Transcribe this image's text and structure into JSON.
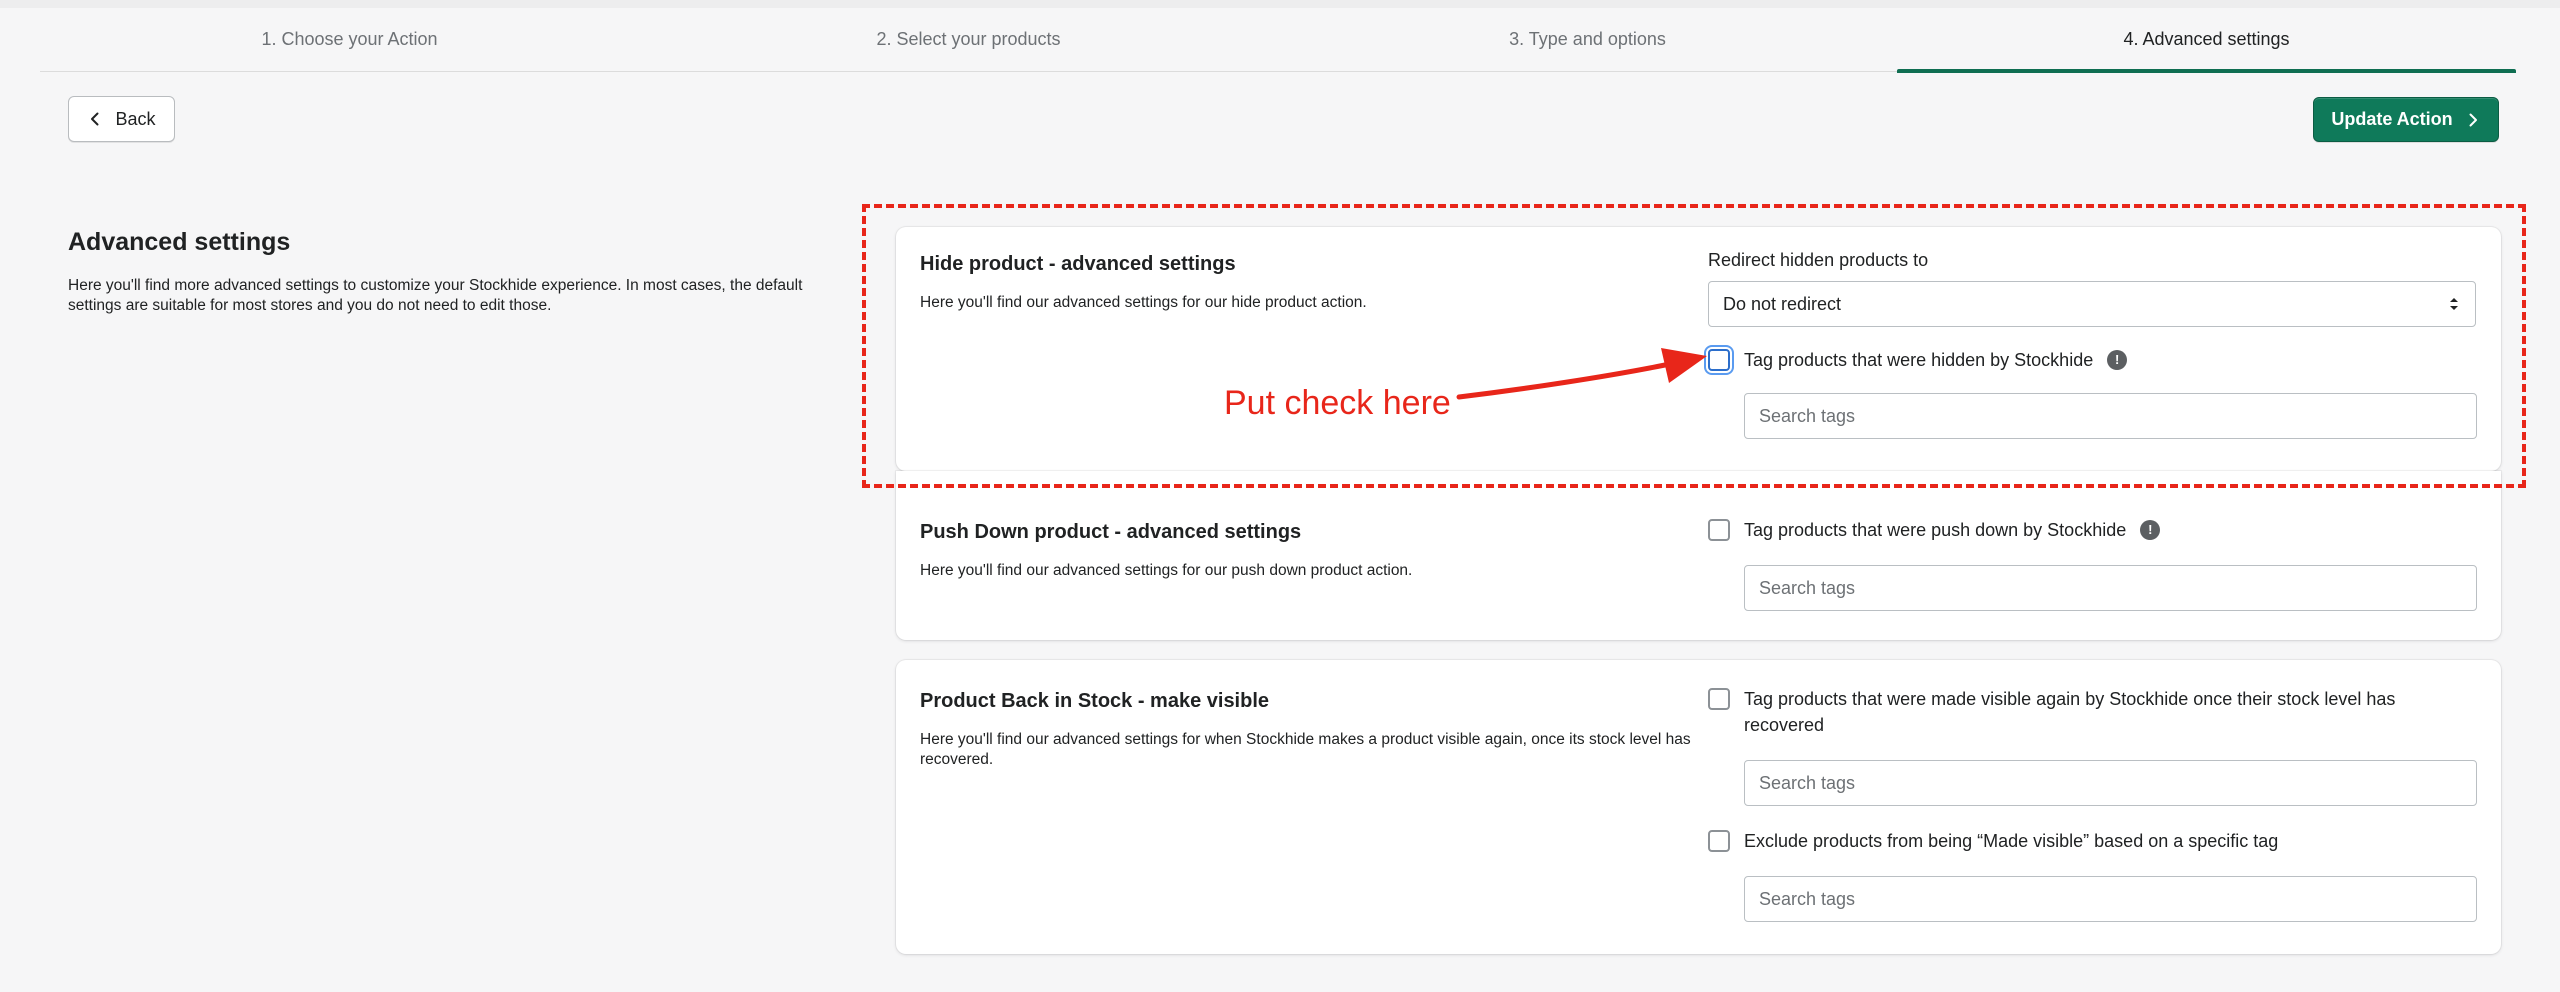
{
  "steps": [
    {
      "label": "1. Choose your Action",
      "active": false
    },
    {
      "label": "2. Select your products",
      "active": false
    },
    {
      "label": "3. Type and options",
      "active": false
    },
    {
      "label": "4. Advanced settings",
      "active": true
    }
  ],
  "toolbar": {
    "back_label": "Back",
    "update_label": "Update Action"
  },
  "page": {
    "title": "Advanced settings",
    "description": "Here you'll find more advanced settings to customize your Stockhide experience. In most cases, the default settings are suitable for most stores and you do not need to edit those."
  },
  "hide_card": {
    "title": "Hide product - advanced settings",
    "description": "Here you'll find our advanced settings for our hide product action.",
    "redirect_label": "Redirect hidden products to",
    "redirect_value": "Do not redirect",
    "checkbox_label": "Tag products that were hidden by Stockhide",
    "checkbox_checked": false,
    "tags_placeholder": "Search tags"
  },
  "pushdown_card": {
    "title": "Push Down product - advanced settings",
    "description": "Here you'll find our advanced settings for our push down product action.",
    "checkbox_label": "Tag products that were push down by Stockhide",
    "checkbox_checked": false,
    "tags_placeholder": "Search tags"
  },
  "backinstock_card": {
    "title": "Product Back in Stock - make visible",
    "description": "Here you'll find our advanced settings for when Stockhide makes a product visible again, once its stock level has recovered.",
    "checkbox1_label": "Tag products that were made visible again by Stockhide once their stock level has recovered",
    "checkbox1_checked": false,
    "tags1_placeholder": "Search tags",
    "checkbox2_label": "Exclude products from being “Made visible” based on a specific tag",
    "checkbox2_checked": false,
    "tags2_placeholder": "Search tags"
  },
  "info_glyph": "!",
  "annotation": {
    "text": "Put check here",
    "color": "#e8261a"
  },
  "colors": {
    "primary": "#0f7a5a",
    "active_tab": "#0f6e52",
    "background": "#f6f6f7"
  },
  "icons": {
    "back": "chevron-left-icon",
    "update": "chevron-right-icon",
    "select": "select-arrows-icon",
    "info": "info-icon"
  }
}
